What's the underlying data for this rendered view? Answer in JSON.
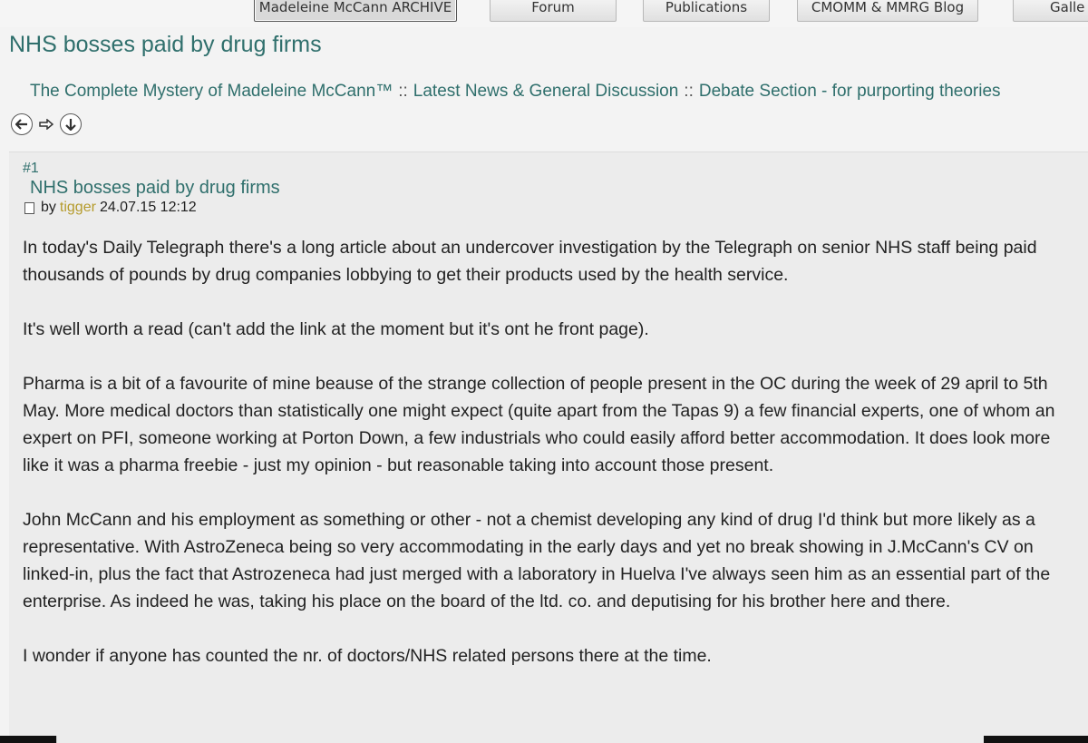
{
  "nav": {
    "items": [
      {
        "label": "Madeleine McCann ARCHIVE"
      },
      {
        "label": "Forum"
      },
      {
        "label": "Publications"
      },
      {
        "label": "CMOMM & MMRG Blog"
      },
      {
        "label": "Galle"
      }
    ]
  },
  "page_title": "NHS bosses paid by drug firms",
  "breadcrumb": {
    "items": [
      "The Complete Mystery of Madeleine McCann™",
      "Latest News & General Discussion",
      "Debate Section - for purporting theories"
    ],
    "separator": "::"
  },
  "navicons": [
    "arrow-left-icon",
    "arrow-right-icon",
    "arrow-down-icon"
  ],
  "post": {
    "number": "#1",
    "title": "NHS bosses paid by drug firms",
    "by_label": "by",
    "author": "tigger",
    "date": "24.07.15 12:12",
    "paragraphs": [
      "In today's Daily Telegraph there's a long article about an undercover investigation by the Telegraph on senior NHS staff being paid thousands of pounds by drug companies lobbying to get their products used by the health service.",
      "It's well worth a read (can't add the link at the moment but it's ont he front page).",
      "Pharma is a bit of a favourite of mine beause of  the strange collection of people present in the OC during the week of 29 april to 5th May. More medical doctors than statistically one might expect (quite apart from the Tapas 9) a few financial experts, one of whom an expert on PFI, someone working at Porton Down, a few industrials who could easily afford better accommodation. It does look more like it was a pharma freebie - just my opinion - but reasonable taking into account those present.",
      "John McCann and his employment as something or other - not a chemist developing  any kind of drug I'd think  but more likely as a representative. With AstroZeneca being so very accommodating in the early days and yet no break showing in J.McCann's CV on linked-in, plus the fact that Astrozeneca had just merged with a laboratory in Huelva I've always seen him as an essential part of the enterprise. As indeed he was, taking his place on the board of the ltd. co. and deputising for his brother here and there.",
      "I wonder if anyone has counted the nr. of doctors/NHS related persons there at the time."
    ]
  },
  "colors": {
    "link": "#2f6f6c",
    "author": "#b59b2c",
    "text": "#222222",
    "background": "#f3f3f3"
  }
}
